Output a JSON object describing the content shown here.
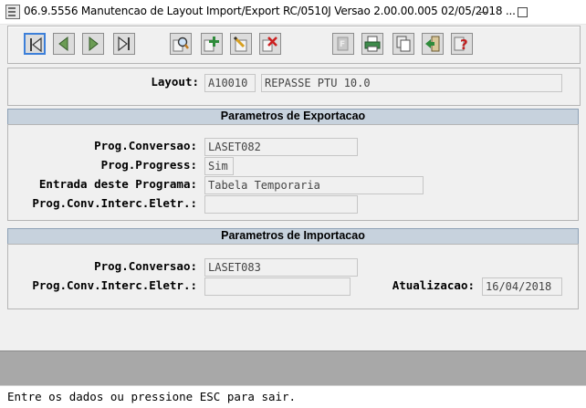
{
  "window": {
    "title": "06.9.5556 Manutencao  de Layout Import/Export RC/0510J Versao 2.00.00.005 02/05/2018 ..."
  },
  "toolbar": {
    "buttons": [
      "first-icon",
      "previous-icon",
      "next-icon",
      "last-icon",
      "zoom-icon",
      "add-icon",
      "edit-icon",
      "delete-icon",
      "disabled-doc-icon",
      "print-icon",
      "copy-icon",
      "exit-icon",
      "help-icon"
    ]
  },
  "layout": {
    "label": "Layout:",
    "code": "A10010",
    "description": "REPASSE PTU 10.0"
  },
  "export": {
    "header": "Parametros de Exportacao",
    "prog_conversao_label": "Prog.Conversao:",
    "prog_conversao_value": "LASET082",
    "prog_progress_label": "Prog.Progress:",
    "prog_progress_value": "Sim",
    "entrada_label": "Entrada deste Programa:",
    "entrada_value": "Tabela Temporaria",
    "prog_conv_interc_label": "Prog.Conv.Interc.Eletr.:",
    "prog_conv_interc_value": ""
  },
  "import": {
    "header": "Parametros de Importacao",
    "prog_conversao_label": "Prog.Conversao:",
    "prog_conversao_value": "LASET083",
    "prog_conv_interc_label": "Prog.Conv.Interc.Eletr.:",
    "prog_conv_interc_value": "",
    "atualizacao_label": "Atualizacao:",
    "atualizacao_value": "16/04/2018"
  },
  "status": {
    "message": "Entre os dados ou pressione ESC para sair."
  }
}
